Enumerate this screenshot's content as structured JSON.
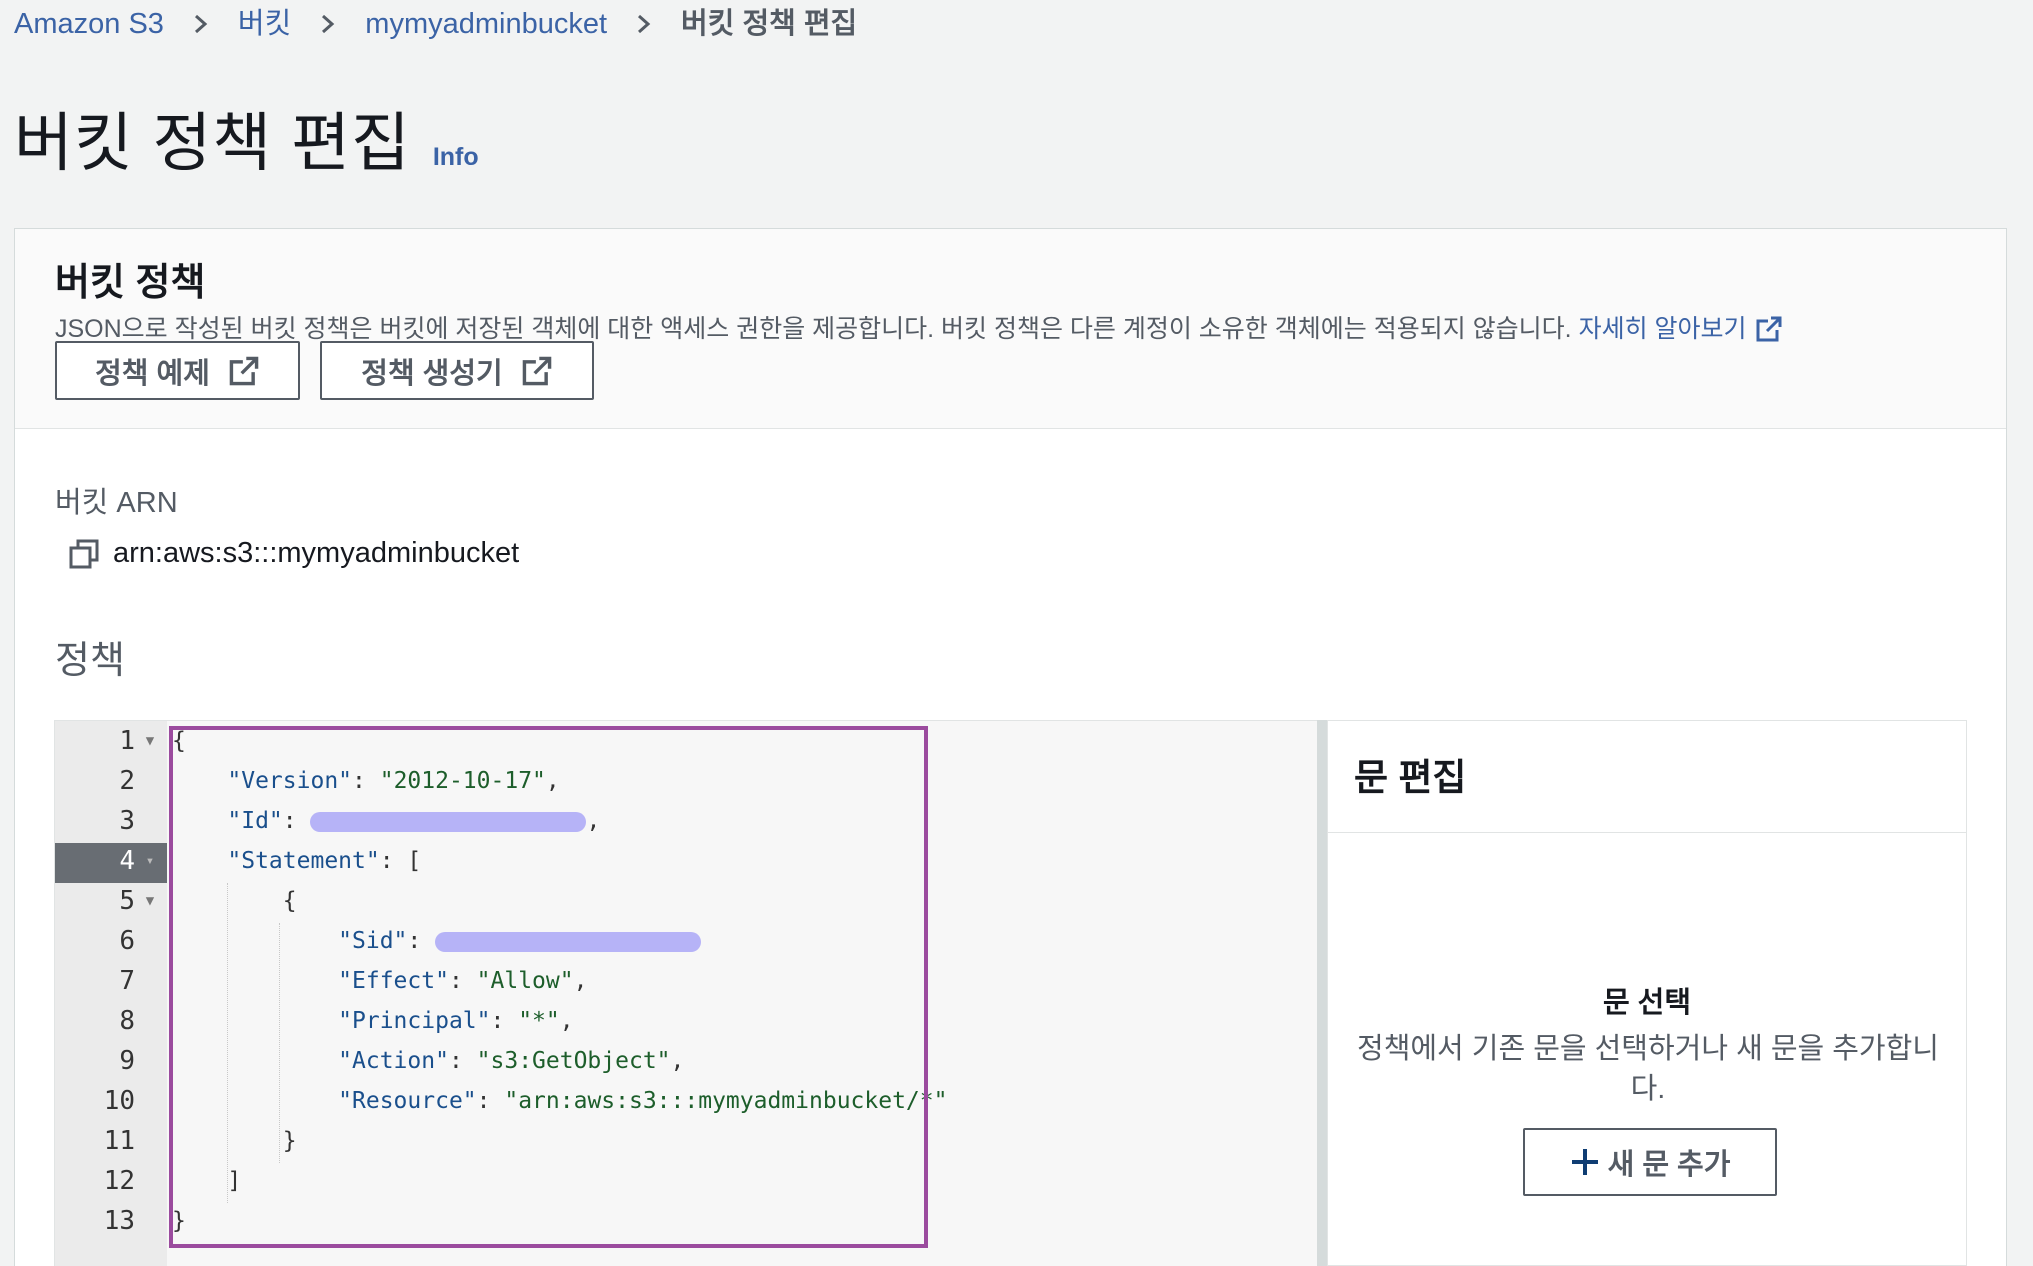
{
  "breadcrumb": {
    "items": [
      "Amazon S3",
      "버킷",
      "mymyadminbucket"
    ],
    "current": "버킷 정책 편집"
  },
  "page": {
    "title": "버킷 정책 편집",
    "info": "Info"
  },
  "section": {
    "title": "버킷 정책",
    "description": "JSON으로 작성된 버킷 정책은 버킷에 저장된 객체에 대한 액세스 권한을 제공합니다. 버킷 정책은 다른 계정이 소유한 객체에는 적용되지 않습니다.",
    "learn_more": "자세히 알아보기",
    "buttons": {
      "examples": "정책 예제",
      "generator": "정책 생성기"
    }
  },
  "arn": {
    "label": "버킷 ARN",
    "value": "arn:aws:s3:::mymyadminbucket"
  },
  "policy": {
    "label": "정책",
    "active_line": 4,
    "lines": {
      "l1": "{",
      "l2k": "\"Version\"",
      "l2v": "\"2012-10-17\"",
      "l3k": "\"Id\"",
      "l4k": "\"Statement\"",
      "l5": "{",
      "l6k": "\"Sid\"",
      "l7k": "\"Effect\"",
      "l7v": "\"Allow\"",
      "l8k": "\"Principal\"",
      "l8v": "\"*\"",
      "l9k": "\"Action\"",
      "l9v": "\"s3:GetObject\"",
      "l10k": "\"Resource\"",
      "l10v": "\"arn:aws:s3:::mymyadminbucket/*\"",
      "l11": "}",
      "l12": "]",
      "l13": "}"
    }
  },
  "statement_panel": {
    "title": "문 편집",
    "empty_title": "문 선택",
    "empty_desc": "정책에서 기존 문을 선택하거나 새 문을 추가합니다.",
    "add_button": "새 문 추가"
  },
  "colors": {
    "link": "#3b63a6",
    "highlight": "#9b4b9e",
    "redaction": "#b6b3f7"
  }
}
